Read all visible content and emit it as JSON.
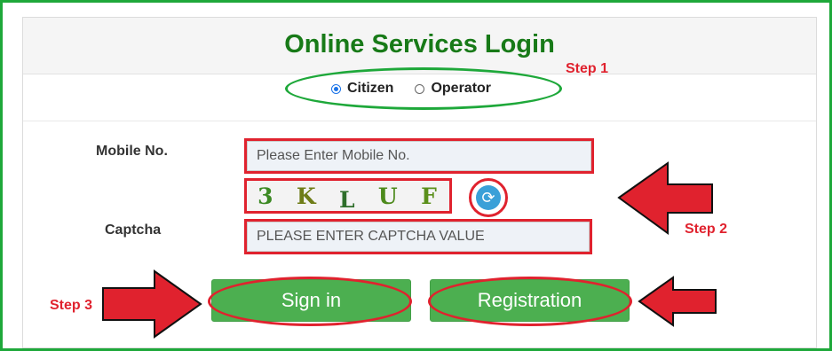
{
  "title": "Online Services Login",
  "login_type": {
    "options": [
      {
        "label": "Citizen",
        "checked": true
      },
      {
        "label": "Operator",
        "checked": false
      }
    ]
  },
  "form": {
    "mobile_label": "Mobile No.",
    "mobile_placeholder": "Please Enter Mobile No.",
    "captcha_label": "Captcha",
    "captcha_chars": [
      "3",
      "K",
      "L",
      "U",
      "F"
    ],
    "captcha_placeholder": "PLEASE ENTER CAPTCHA VALUE"
  },
  "buttons": {
    "signin": "Sign in",
    "registration": "Registration"
  },
  "steps": {
    "step1": "Step 1",
    "step2": "Step 2",
    "step3": "Step 3"
  },
  "colors": {
    "title_green": "#187a18",
    "button_green": "#4caf50",
    "annotation_red": "#e0222e",
    "highlight_green": "#1ea83a"
  },
  "icons": {
    "refresh": "refresh-icon",
    "arrow": "right-arrow-icon"
  }
}
